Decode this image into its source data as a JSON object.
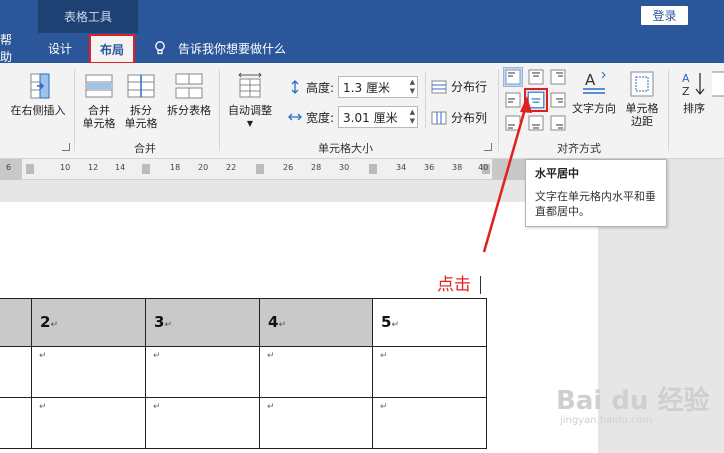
{
  "titlebar": {
    "context_group": "表格工具",
    "login_label": "登录"
  },
  "tabs": [
    {
      "label": "帮助"
    },
    {
      "label": "设计"
    },
    {
      "label": "布局"
    }
  ],
  "tell_me": "告诉我你想要做什么",
  "ribbon": {
    "insert_right": "在右侧插入",
    "merge_cells": [
      "合并",
      "单元格"
    ],
    "split_cells": [
      "拆分",
      "单元格"
    ],
    "split_table": "拆分表格",
    "group_merge": "合并",
    "autofit": "自动调整",
    "height_label": "高度:",
    "height_value": "1.3 厘米",
    "width_label": "宽度:",
    "width_value": "3.01 厘米",
    "distribute_rows": "分布行",
    "distribute_cols": "分布列",
    "group_cell_size": "单元格大小",
    "text_direction": "文字方向",
    "cell_margins": [
      "单元格",
      "边距"
    ],
    "group_alignment": "对齐方式",
    "sort": "排序"
  },
  "ruler": {
    "ticks": [
      "6",
      "10",
      "12",
      "14",
      "18",
      "20",
      "22",
      "26",
      "28",
      "30",
      "34",
      "36",
      "38",
      "40"
    ]
  },
  "tooltip": {
    "title": "水平居中",
    "description": "文字在单元格内水平和垂直都居中。"
  },
  "annotation": {
    "click_hint": "点击"
  },
  "table": {
    "header": [
      "2",
      "3",
      "4",
      "5"
    ],
    "paragraph_mark": "↵"
  },
  "watermark": {
    "main": "Bai du 经验",
    "sub": "jingyan.baidu.com"
  },
  "colors": {
    "brand_blue": "#2b579a",
    "highlight_red": "#e21f1f"
  }
}
